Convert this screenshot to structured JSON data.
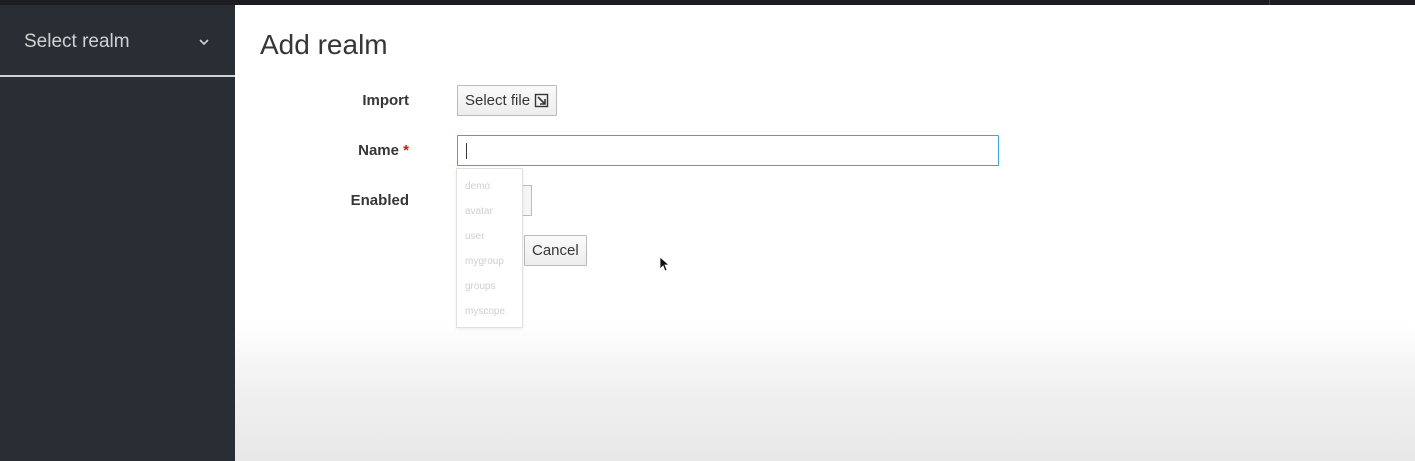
{
  "sidebar": {
    "realm_selector_label": "Select realm"
  },
  "main": {
    "title": "Add realm",
    "form": {
      "import_label": "Import",
      "select_file_label": "Select file",
      "name_label": "Name",
      "required_marker": "*",
      "name_value": "",
      "enabled_label": "Enabled",
      "cancel_label": "Cancel"
    },
    "autocomplete": {
      "items": [
        "demo",
        "avatar",
        "user",
        "mygroup",
        "groups",
        "myscope"
      ]
    }
  },
  "colors": {
    "sidebar_bg": "#292e34",
    "input_focus_border": "#39a5dc",
    "required": "#c9190b"
  },
  "icons": {
    "realm_dropdown": "chevron-down-icon",
    "select_file": "import-icon"
  }
}
